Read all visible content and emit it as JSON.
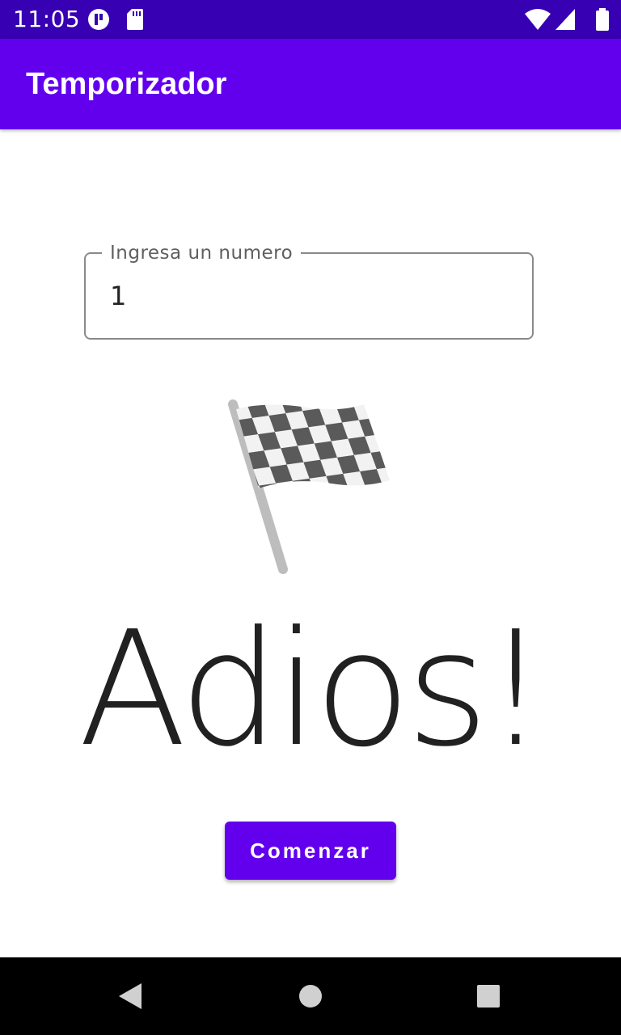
{
  "status_bar": {
    "time": "11:05",
    "icons": [
      "app-notification-icon",
      "sd-card-icon",
      "wifi-icon",
      "cell-signal-icon",
      "battery-icon"
    ]
  },
  "app_bar": {
    "title": "Temporizador",
    "color": "#6200ee"
  },
  "input": {
    "label": "Ingresa un numero",
    "value": "1"
  },
  "emoji": "checkered-flag-icon",
  "message": "Adios!",
  "start_button": {
    "label": "Comenzar",
    "color": "#6200ee"
  },
  "nav_bar": {
    "buttons": [
      "back-icon",
      "home-icon",
      "recents-icon"
    ]
  }
}
